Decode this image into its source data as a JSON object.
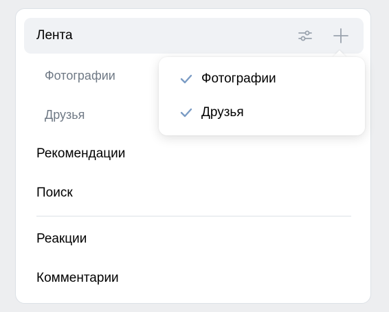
{
  "menu": {
    "feed_label": "Лента",
    "items": [
      {
        "label": "Фотографии"
      },
      {
        "label": "Друзья"
      },
      {
        "label": "Рекомендации"
      },
      {
        "label": "Поиск"
      },
      {
        "label": "Реакции"
      },
      {
        "label": "Комментарии"
      }
    ],
    "actions": {
      "filter_icon": "settings-sliders-icon",
      "add_icon": "plus-icon"
    }
  },
  "dropdown": {
    "items": [
      {
        "label": "Фотографии",
        "checked": true
      },
      {
        "label": "Друзья",
        "checked": true
      }
    ]
  },
  "colors": {
    "background": "#edeef0",
    "active_bg": "#f0f2f5",
    "sub_text": "#6f7985",
    "icon": "#99a2ad",
    "check": "#7a9bc4"
  }
}
